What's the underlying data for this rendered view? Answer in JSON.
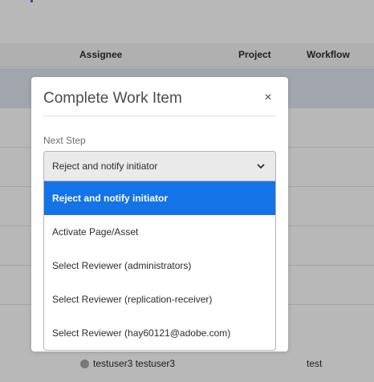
{
  "table": {
    "columns": {
      "assignee": "Assignee",
      "project": "Project",
      "workflow": "Workflow"
    },
    "last_row": {
      "assignee": "testuser3 testuser3",
      "workflow": "test"
    }
  },
  "dialog": {
    "title": "Complete Work Item",
    "close_glyph": "×",
    "next_step_label": "Next Step",
    "selected_value": "Reject and notify initiator",
    "options": [
      "Reject and notify initiator",
      "Activate Page/Asset",
      "Select Reviewer (administrators)",
      "Select Reviewer (replication-receiver)",
      "Select Reviewer (hay60121@adobe.com)"
    ]
  },
  "colors": {
    "accent": "#1473e6",
    "selected_row": "#dfe6f0"
  }
}
